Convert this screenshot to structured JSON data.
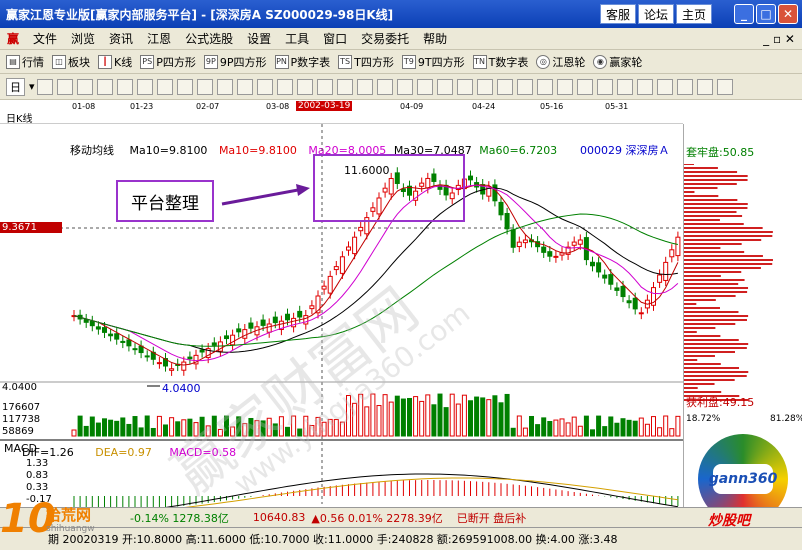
{
  "window": {
    "title": "赢家江恩专业版[赢家内部服务平台] - [深深房A   SZ000029-98日K线]",
    "buttons": [
      "客服",
      "论坛",
      "主页"
    ]
  },
  "menu": [
    "文件",
    "浏览",
    "资讯",
    "江恩",
    "公式选股",
    "设置",
    "工具",
    "窗口",
    "交易委托",
    "帮助"
  ],
  "toolbar1": [
    "行情",
    "板块",
    "K线",
    "P四方形",
    "9P四方形",
    "P数字表",
    "T四方形",
    "9T四方形",
    "T数字表",
    "江恩轮",
    "赢家轮"
  ],
  "toolbar2": {
    "period": "日"
  },
  "chart": {
    "panel_label": "日K线",
    "indicator_name": "移动均线",
    "ma_values": [
      "Ma10=9.8100",
      "Ma10=9.8100",
      "Ma20=8.0005",
      "Ma30=7.0487",
      "Ma60=6.7203"
    ],
    "stock_label": "000029  深深房Ａ",
    "dates": [
      "01-08",
      "01-23",
      "02-07",
      "03-08",
      "2002-03-19",
      "04-09",
      "04-24",
      "05-16",
      "05-31"
    ],
    "high_label": "11.6000",
    "low_label": "4.0400",
    "low_axis": "4.0400",
    "crosshair_price": "9.3671",
    "annotation": "平台整理",
    "volume_ticks": [
      "176607",
      "117738",
      "58869"
    ],
    "macd": {
      "label": "MACD",
      "dif": "DIF=1.26",
      "dea": "DEA=0.97",
      "macd": "MACD=0.58",
      "ticks": [
        "1.33",
        "0.83",
        "0.33",
        "-0.17"
      ]
    }
  },
  "right_panel": {
    "trapped": "套牢盘:50.85",
    "profit": "获利盘:49.15",
    "pct_left": "18.72%",
    "pct_right": "81.28%",
    "logo": "gann360"
  },
  "watermark": "赢家财富网 www.yingjia360.com",
  "status": {
    "index1": "-0.14%  1278.38亿",
    "index2_value": "10640.83",
    "index2_change": "▲0.56  0.01%  2278.39亿",
    "right_text": "已断开  盘后补",
    "brand": "炒股吧"
  },
  "bottom": {
    "text": "期 20020319  开:10.8000  高:11.6000  低:10.7000  收:11.0000  手:240828  额:269591008.00  换:4.00  涨:3.48"
  },
  "site_logo": {
    "number": "10",
    "name": "拾荒网",
    "sub": "shihuangw"
  },
  "colors": {
    "up": "#e00000",
    "down": "#008000",
    "ma_black": "#000000",
    "ma_red": "#c00000",
    "ma_magenta": "#d000d0",
    "ma_green": "#008000",
    "annotation": "#9933cc"
  }
}
